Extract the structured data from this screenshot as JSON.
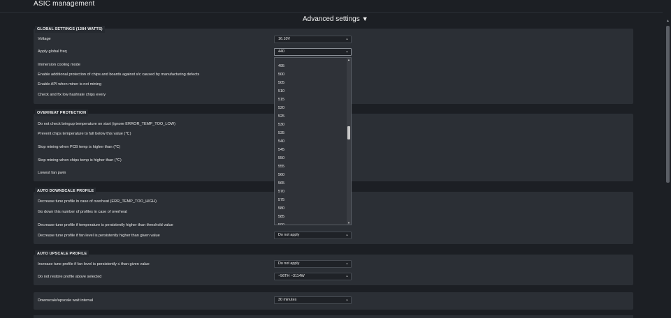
{
  "page": {
    "title": "ASIC management",
    "advanced_toggle": "Advanced settings",
    "advanced_caret": "▼"
  },
  "sections": {
    "global": {
      "label": "GLOBAL SETTINGS (1284 WATTS)",
      "voltage_label": "Voltage",
      "voltage_value": "16.10V",
      "freq_label": "Apply global freq",
      "freq_value": "440",
      "immersion_label": "Immersion cooling mode",
      "protection_label": "Enable additional protection of chips and boards against s/c caused by manufacturing defects",
      "api_label": "Enable API when miner is not mining",
      "lowhash_label": "Check and fix low hashrate chips every"
    },
    "overheat": {
      "label": "OVERHEAT PROTECTION",
      "bringup_label": "Do not check bringup temperature on start (ignore ERROR_TEMP_TOO_LOW)",
      "prevent_label": "Prevent chips temperature to fall below this value (℃)",
      "pcb_label": "Stop mining when PCB temp is higher than (℃)",
      "chips_label": "Stop mining when chips temp is higher than (℃)",
      "fan_label": "Lowest fan pwm"
    },
    "downscale": {
      "label": "AUTO DOWNSCALE PROFILE",
      "decrease_label": "Decrease tune profile in case of overheat (ERR_TEMP_TOO_HIGH)",
      "godown_label": "Go down this number of profiles in case of overheat",
      "temp_label": "Decrease tune profile if temperature is persistently higher than threshold value",
      "fan_label": "Decrease tune profile if fan level is persistently higher than given value",
      "fan_value": "Do not apply"
    },
    "upscale": {
      "label": "AUTO UPSCALE PROFILE",
      "increase_label": "Increase tune profile if fan level is persistently ≤ than given value",
      "increase_value": "Do not apply",
      "restore_label": "Do not restore profile above selected",
      "restore_value": "~56TH ~3114W"
    },
    "interval": {
      "label": "Downscale/upscale wait interval",
      "value": "30 minutes"
    }
  },
  "dropdown": {
    "options": [
      "490",
      "495",
      "500",
      "505",
      "510",
      "515",
      "520",
      "525",
      "530",
      "535",
      "540",
      "545",
      "550",
      "555",
      "560",
      "565",
      "570",
      "575",
      "580",
      "585",
      "590"
    ]
  },
  "icons": {
    "chevron": "⌄",
    "scroll_up": "▲",
    "scroll_down": "▼"
  },
  "colors": {
    "background": "#1c1f24",
    "panel": "#2b2f35",
    "select_bg": "#1f2227",
    "dropdown_bg": "#2f3238"
  }
}
